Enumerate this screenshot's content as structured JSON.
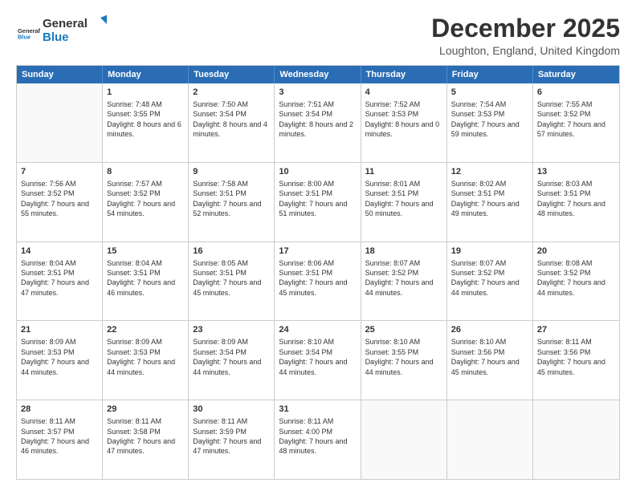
{
  "logo": {
    "line1": "General",
    "line2": "Blue"
  },
  "title": "December 2025",
  "location": "Loughton, England, United Kingdom",
  "days_of_week": [
    "Sunday",
    "Monday",
    "Tuesday",
    "Wednesday",
    "Thursday",
    "Friday",
    "Saturday"
  ],
  "weeks": [
    [
      {
        "day": "",
        "sunrise": "",
        "sunset": "",
        "daylight": "",
        "empty": true
      },
      {
        "day": "1",
        "sunrise": "Sunrise: 7:48 AM",
        "sunset": "Sunset: 3:55 PM",
        "daylight": "Daylight: 8 hours and 6 minutes."
      },
      {
        "day": "2",
        "sunrise": "Sunrise: 7:50 AM",
        "sunset": "Sunset: 3:54 PM",
        "daylight": "Daylight: 8 hours and 4 minutes."
      },
      {
        "day": "3",
        "sunrise": "Sunrise: 7:51 AM",
        "sunset": "Sunset: 3:54 PM",
        "daylight": "Daylight: 8 hours and 2 minutes."
      },
      {
        "day": "4",
        "sunrise": "Sunrise: 7:52 AM",
        "sunset": "Sunset: 3:53 PM",
        "daylight": "Daylight: 8 hours and 0 minutes."
      },
      {
        "day": "5",
        "sunrise": "Sunrise: 7:54 AM",
        "sunset": "Sunset: 3:53 PM",
        "daylight": "Daylight: 7 hours and 59 minutes."
      },
      {
        "day": "6",
        "sunrise": "Sunrise: 7:55 AM",
        "sunset": "Sunset: 3:52 PM",
        "daylight": "Daylight: 7 hours and 57 minutes."
      }
    ],
    [
      {
        "day": "7",
        "sunrise": "Sunrise: 7:56 AM",
        "sunset": "Sunset: 3:52 PM",
        "daylight": "Daylight: 7 hours and 55 minutes."
      },
      {
        "day": "8",
        "sunrise": "Sunrise: 7:57 AM",
        "sunset": "Sunset: 3:52 PM",
        "daylight": "Daylight: 7 hours and 54 minutes."
      },
      {
        "day": "9",
        "sunrise": "Sunrise: 7:58 AM",
        "sunset": "Sunset: 3:51 PM",
        "daylight": "Daylight: 7 hours and 52 minutes."
      },
      {
        "day": "10",
        "sunrise": "Sunrise: 8:00 AM",
        "sunset": "Sunset: 3:51 PM",
        "daylight": "Daylight: 7 hours and 51 minutes."
      },
      {
        "day": "11",
        "sunrise": "Sunrise: 8:01 AM",
        "sunset": "Sunset: 3:51 PM",
        "daylight": "Daylight: 7 hours and 50 minutes."
      },
      {
        "day": "12",
        "sunrise": "Sunrise: 8:02 AM",
        "sunset": "Sunset: 3:51 PM",
        "daylight": "Daylight: 7 hours and 49 minutes."
      },
      {
        "day": "13",
        "sunrise": "Sunrise: 8:03 AM",
        "sunset": "Sunset: 3:51 PM",
        "daylight": "Daylight: 7 hours and 48 minutes."
      }
    ],
    [
      {
        "day": "14",
        "sunrise": "Sunrise: 8:04 AM",
        "sunset": "Sunset: 3:51 PM",
        "daylight": "Daylight: 7 hours and 47 minutes."
      },
      {
        "day": "15",
        "sunrise": "Sunrise: 8:04 AM",
        "sunset": "Sunset: 3:51 PM",
        "daylight": "Daylight: 7 hours and 46 minutes."
      },
      {
        "day": "16",
        "sunrise": "Sunrise: 8:05 AM",
        "sunset": "Sunset: 3:51 PM",
        "daylight": "Daylight: 7 hours and 45 minutes."
      },
      {
        "day": "17",
        "sunrise": "Sunrise: 8:06 AM",
        "sunset": "Sunset: 3:51 PM",
        "daylight": "Daylight: 7 hours and 45 minutes."
      },
      {
        "day": "18",
        "sunrise": "Sunrise: 8:07 AM",
        "sunset": "Sunset: 3:52 PM",
        "daylight": "Daylight: 7 hours and 44 minutes."
      },
      {
        "day": "19",
        "sunrise": "Sunrise: 8:07 AM",
        "sunset": "Sunset: 3:52 PM",
        "daylight": "Daylight: 7 hours and 44 minutes."
      },
      {
        "day": "20",
        "sunrise": "Sunrise: 8:08 AM",
        "sunset": "Sunset: 3:52 PM",
        "daylight": "Daylight: 7 hours and 44 minutes."
      }
    ],
    [
      {
        "day": "21",
        "sunrise": "Sunrise: 8:09 AM",
        "sunset": "Sunset: 3:53 PM",
        "daylight": "Daylight: 7 hours and 44 minutes."
      },
      {
        "day": "22",
        "sunrise": "Sunrise: 8:09 AM",
        "sunset": "Sunset: 3:53 PM",
        "daylight": "Daylight: 7 hours and 44 minutes."
      },
      {
        "day": "23",
        "sunrise": "Sunrise: 8:09 AM",
        "sunset": "Sunset: 3:54 PM",
        "daylight": "Daylight: 7 hours and 44 minutes."
      },
      {
        "day": "24",
        "sunrise": "Sunrise: 8:10 AM",
        "sunset": "Sunset: 3:54 PM",
        "daylight": "Daylight: 7 hours and 44 minutes."
      },
      {
        "day": "25",
        "sunrise": "Sunrise: 8:10 AM",
        "sunset": "Sunset: 3:55 PM",
        "daylight": "Daylight: 7 hours and 44 minutes."
      },
      {
        "day": "26",
        "sunrise": "Sunrise: 8:10 AM",
        "sunset": "Sunset: 3:56 PM",
        "daylight": "Daylight: 7 hours and 45 minutes."
      },
      {
        "day": "27",
        "sunrise": "Sunrise: 8:11 AM",
        "sunset": "Sunset: 3:56 PM",
        "daylight": "Daylight: 7 hours and 45 minutes."
      }
    ],
    [
      {
        "day": "28",
        "sunrise": "Sunrise: 8:11 AM",
        "sunset": "Sunset: 3:57 PM",
        "daylight": "Daylight: 7 hours and 46 minutes."
      },
      {
        "day": "29",
        "sunrise": "Sunrise: 8:11 AM",
        "sunset": "Sunset: 3:58 PM",
        "daylight": "Daylight: 7 hours and 47 minutes."
      },
      {
        "day": "30",
        "sunrise": "Sunrise: 8:11 AM",
        "sunset": "Sunset: 3:59 PM",
        "daylight": "Daylight: 7 hours and 47 minutes."
      },
      {
        "day": "31",
        "sunrise": "Sunrise: 8:11 AM",
        "sunset": "Sunset: 4:00 PM",
        "daylight": "Daylight: 7 hours and 48 minutes."
      },
      {
        "day": "",
        "sunrise": "",
        "sunset": "",
        "daylight": "",
        "empty": true
      },
      {
        "day": "",
        "sunrise": "",
        "sunset": "",
        "daylight": "",
        "empty": true
      },
      {
        "day": "",
        "sunrise": "",
        "sunset": "",
        "daylight": "",
        "empty": true
      }
    ]
  ]
}
